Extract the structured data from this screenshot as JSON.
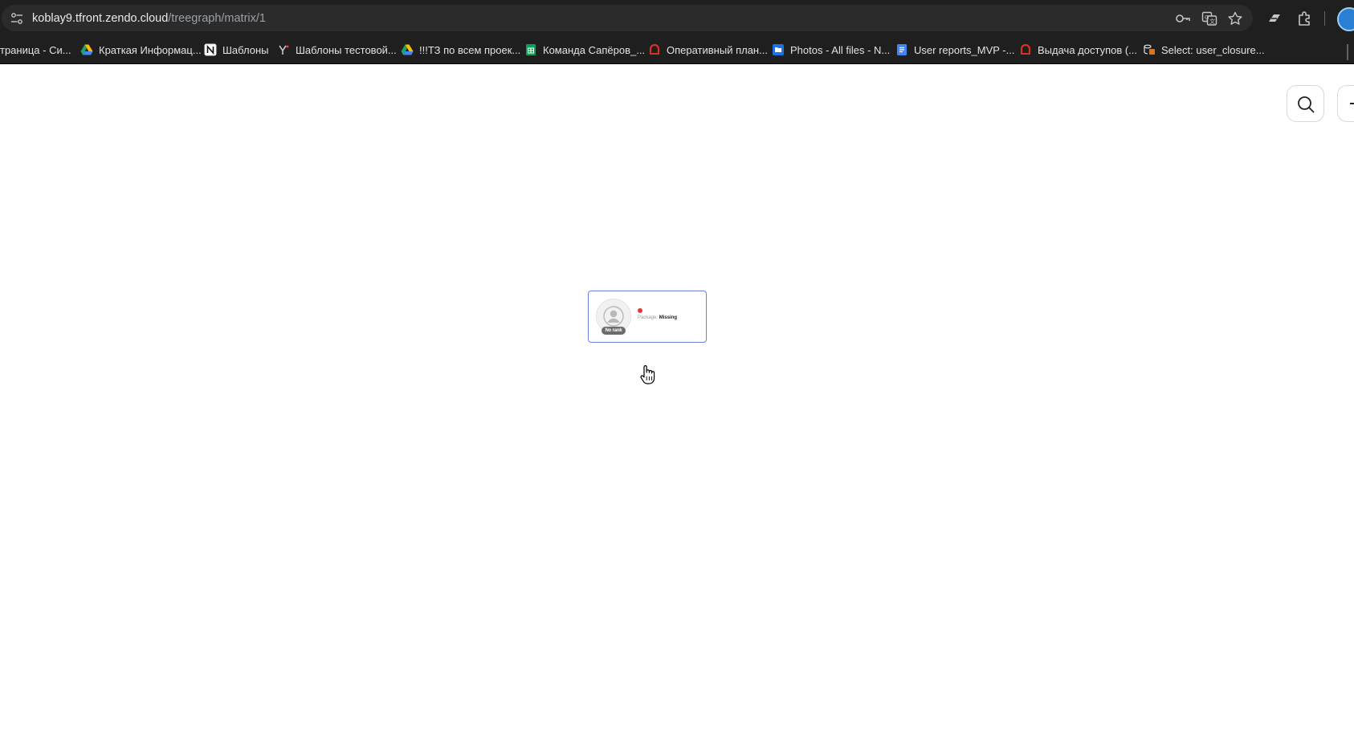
{
  "browser": {
    "url_host": "koblay9.tfront.zendo.cloud",
    "url_path": "/treegraph/matrix/1",
    "bookmarks": [
      {
        "label": "траница - Си...",
        "icon": "none"
      },
      {
        "label": "Краткая Информац...",
        "icon": "google-drive-icon"
      },
      {
        "label": "Шаблоны",
        "icon": "notion-icon"
      },
      {
        "label": "Шаблоны тестовой...",
        "icon": "yandex-icon"
      },
      {
        "label": "!!!ТЗ по всем проек...",
        "icon": "google-drive-icon"
      },
      {
        "label": "Команда Сапёров_...",
        "icon": "google-sheets-icon"
      },
      {
        "label": "Оперативный план...",
        "icon": "red-logo-icon"
      },
      {
        "label": "Photos - All files - N...",
        "icon": "folder-icon"
      },
      {
        "label": "User reports_MVP -...",
        "icon": "google-docs-icon"
      },
      {
        "label": "Выдача доступов (...",
        "icon": "red-logo-icon"
      },
      {
        "label": "Select: user_closure...",
        "icon": "database-icon"
      }
    ]
  },
  "page": {
    "node": {
      "rank_label": "No rank",
      "package_key": "Package:",
      "package_value": "Missing",
      "status_color": "#e53935",
      "border_color": "#6d7fe0"
    }
  }
}
